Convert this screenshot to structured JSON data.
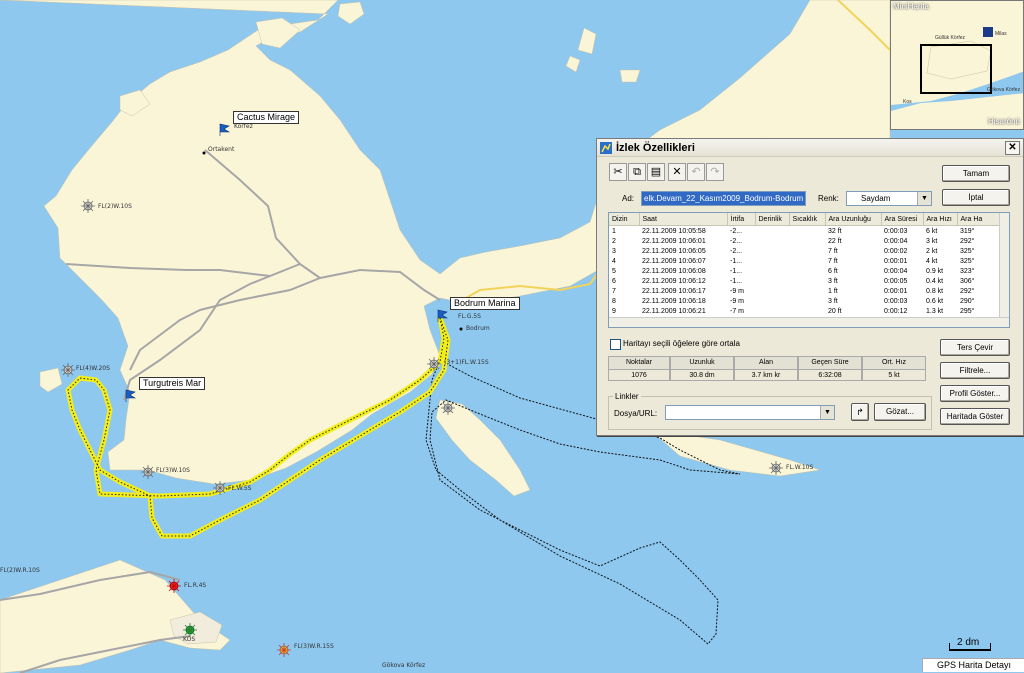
{
  "map": {
    "labels": {
      "cactus": "Cactus Mirage",
      "bodrum_marina": "Bodrum Marina",
      "turgutreis": "Turgutreis Mar",
      "ortakent": "Ortakent",
      "korfez": "Körfez",
      "bodrum": "Bodrum",
      "fl_top": "FL(2)W.10S",
      "fl_left": "FL(4)W.20S",
      "fl3": "FL(3)W.10S",
      "flw5": "FL.W.5S",
      "flg": "FL.G.5S",
      "fl2": "(3+1)FL.W.15S",
      "flw10": "FL.W.10S",
      "flr": "FL.R.4S",
      "fl_left_edge": "FL(2)W.R.10S",
      "kos": "KOS",
      "fl3wr": "FL(3)W.R.15S",
      "gokova": "Gökova Körfez"
    },
    "track_color": "#f2ee1c",
    "water_color": "#8ec8ef",
    "land_color": "#fbf5d8"
  },
  "minimap": {
    "title": "MiniHarita",
    "bottom_label": "Hisarönü",
    "labels": [
      "Güllük Körfez",
      "Milas",
      "Gökova Körfez",
      "Kos"
    ]
  },
  "dialog": {
    "title": "İzlek Özellikleri",
    "name_label": "Ad:",
    "name_value": "elk.Devam_22_Kasım2009_Bodrum-Bodrum",
    "color_label": "Renk:",
    "color_value": "Saydam",
    "ok": "Tamam",
    "cancel": "İptal",
    "columns": [
      "Dizin",
      "Saat",
      "İrtifa",
      "Derinlik",
      "Sıcaklık",
      "Ara Uzunluğu",
      "Ara Süresi",
      "Ara Hızı",
      "Ara Ha"
    ],
    "rows": [
      [
        "1",
        "22.11.2009 10:05:58",
        "-2...",
        "",
        "",
        "32 ft",
        "0:00:03",
        "6 kt",
        "319°"
      ],
      [
        "2",
        "22.11.2009 10:06:01",
        "-2...",
        "",
        "",
        "22 ft",
        "0:00:04",
        "3 kt",
        "292°"
      ],
      [
        "3",
        "22.11.2009 10:06:05",
        "-2...",
        "",
        "",
        "7 ft",
        "0:00:02",
        "2 kt",
        "325°"
      ],
      [
        "4",
        "22.11.2009 10:06:07",
        "-1...",
        "",
        "",
        "7 ft",
        "0:00:01",
        "4 kt",
        "325°"
      ],
      [
        "5",
        "22.11.2009 10:06:08",
        "-1...",
        "",
        "",
        "6 ft",
        "0:00:04",
        "0.9 kt",
        "323°"
      ],
      [
        "6",
        "22.11.2009 10:06:12",
        "-1...",
        "",
        "",
        "3 ft",
        "0:00:05",
        "0.4 kt",
        "306°"
      ],
      [
        "7",
        "22.11.2009 10:06:17",
        "-9 m",
        "",
        "",
        "1 ft",
        "0:00:01",
        "0.8 kt",
        "292°"
      ],
      [
        "8",
        "22.11.2009 10:06:18",
        "-9 m",
        "",
        "",
        "3 ft",
        "0:00:03",
        "0.6 kt",
        "290°"
      ],
      [
        "9",
        "22.11.2009 10:06:21",
        "-7 m",
        "",
        "",
        "20 ft",
        "0:00:12",
        "1.3 kt",
        "295°"
      ]
    ],
    "center_checkbox": "Haritayı seçili öğelere göre ortala",
    "reverse": "Ters Çevir",
    "stats_headers": [
      "Noktalar",
      "Uzunluk",
      "Alan",
      "Geçen Süre",
      "Ort. Hız"
    ],
    "stats_values": [
      "1076",
      "30.8 dm",
      "3.7 km kr",
      "6:32:08",
      "5 kt"
    ],
    "filter": "Filtrele...",
    "links_label": "Linkler",
    "file_url_label": "Dosya/URL:",
    "browse": "Gözat...",
    "profile": "Profil Göster...",
    "show_map": "Haritada Göster"
  },
  "scale": "2 dm",
  "status": "GPS Harita Detayı"
}
